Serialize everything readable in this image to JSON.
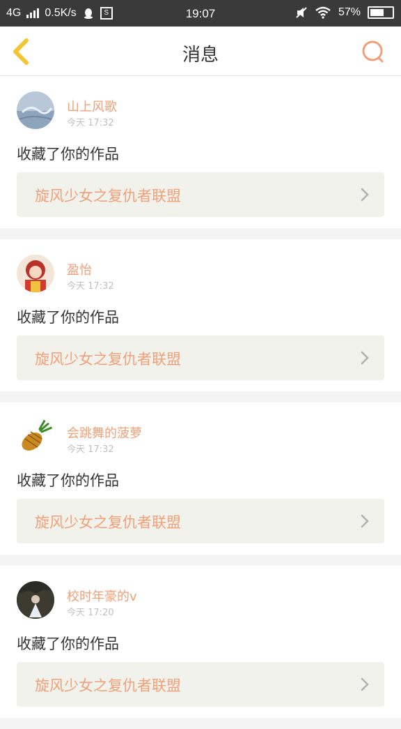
{
  "status_bar": {
    "network": "4G",
    "speed": "0.5K/s",
    "time": "19:07",
    "battery": "57%",
    "qq_icon": "qq-icon",
    "app_icon": "s-icon"
  },
  "header": {
    "title": "消息",
    "back_icon": "chevron-left-icon",
    "search_icon": "search-icon"
  },
  "colors": {
    "accent": "#f0a078",
    "back_yellow": "#f2c531",
    "card_bg": "#f2f2ec",
    "text_dark": "#333333"
  },
  "messages": [
    {
      "username": "山上风歌",
      "time": "今天 17:32",
      "action": "收藏了你的作品",
      "work_title": "旋风少女之复仇者联盟",
      "avatar": "landscape-avatar"
    },
    {
      "username": "盈怡",
      "time": "今天 17:32",
      "action": "收藏了你的作品",
      "work_title": "旋风少女之复仇者联盟",
      "avatar": "anime-girl-avatar"
    },
    {
      "username": "会跳舞的菠萝",
      "time": "今天 17:32",
      "action": "收藏了你的作品",
      "work_title": "旋风少女之复仇者联盟",
      "avatar": "pineapple-avatar"
    },
    {
      "username": "校时年豪的v",
      "time": "今天 17:20",
      "action": "收藏了你的作品",
      "work_title": "旋风少女之复仇者联盟",
      "avatar": "dark-photo-avatar"
    }
  ]
}
